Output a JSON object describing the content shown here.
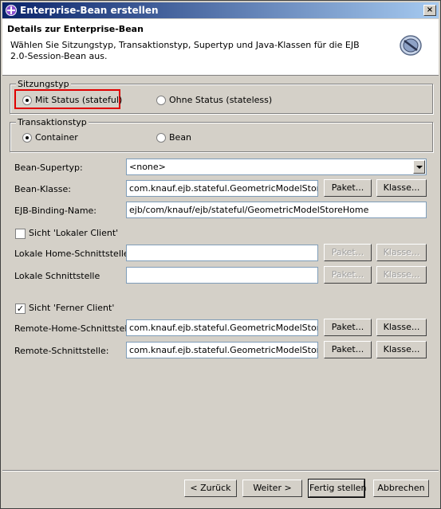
{
  "window": {
    "title": "Enterprise-Bean erstellen",
    "close_label": "×"
  },
  "header": {
    "title": "Details zur Enterprise-Bean",
    "description": "Wählen Sie Sitzungstyp, Transaktionstyp, Supertyp und Java-Klassen für die EJB 2.0-Session-Bean aus.",
    "icon": "ejb-wizard-icon"
  },
  "session_type": {
    "legend": "Sitzungstyp",
    "options": [
      {
        "label": "Mit Status (stateful)",
        "selected": true
      },
      {
        "label": "Ohne Status (stateless)",
        "selected": false
      }
    ]
  },
  "transaction_type": {
    "legend": "Transaktionstyp",
    "options": [
      {
        "label": "Container",
        "selected": true
      },
      {
        "label": "Bean",
        "selected": false
      }
    ]
  },
  "form": {
    "supertype_label": "Bean-Supertyp:",
    "supertype_value": "<none>",
    "bean_class_label": "Bean-Klasse:",
    "bean_class_value": "com.knauf.ejb.stateful.GeometricModelStoreBea",
    "binding_label": "EJB-Binding-Name:",
    "binding_value": "ejb/com/knauf/ejb/stateful/GeometricModelStoreHome",
    "package_button": "Paket...",
    "class_button": "Klasse..."
  },
  "local_client": {
    "checkbox_label": "Sicht 'Lokaler Client'",
    "checked": false,
    "home_label": "Lokale Home-Schnittstelle:",
    "home_value": "",
    "interface_label": "Lokale Schnittstelle",
    "interface_value": ""
  },
  "remote_client": {
    "checkbox_label": "Sicht 'Ferner Client'",
    "checked": true,
    "checkmark": "✓",
    "home_label": "Remote-Home-Schnittstelle:",
    "home_value": "com.knauf.ejb.stateful.GeometricModelStoreHor",
    "interface_label": "Remote-Schnittstelle:",
    "interface_value": "com.knauf.ejb.stateful.GeometricModelStore"
  },
  "footer": {
    "back": "< Zurück",
    "next": "Weiter >",
    "finish": "Fertig stellen",
    "cancel": "Abbrechen"
  }
}
